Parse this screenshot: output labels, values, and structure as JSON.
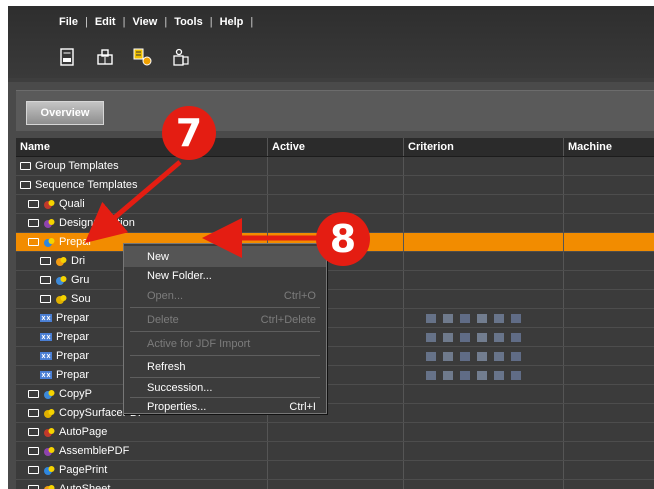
{
  "menu": {
    "items": [
      "File",
      "Edit",
      "View",
      "Tools",
      "Help"
    ]
  },
  "toolbar": {
    "icons": [
      "document-abc-icon",
      "printer-pages-icon",
      "workflow-settings-icon",
      "user-organizer-icon"
    ]
  },
  "overview_tab": "Overview",
  "columns": [
    "Name",
    "Active",
    "Criterion",
    "Machine"
  ],
  "rows": [
    {
      "name": "Group Templates",
      "indent": 0,
      "icon": "folder",
      "selected": false
    },
    {
      "name": "Sequence Templates",
      "indent": 0,
      "icon": "folder-open",
      "selected": false
    },
    {
      "name": "Quali",
      "indent": 1,
      "icon": "folder-badge",
      "selected": false
    },
    {
      "name": "DesignCreation",
      "indent": 1,
      "icon": "folder-badge",
      "selected": false
    },
    {
      "name": "Prepar",
      "indent": 1,
      "icon": "folder-open-badge",
      "selected": true
    },
    {
      "name": "Dri",
      "indent": 2,
      "icon": "folder-badge",
      "selected": false
    },
    {
      "name": "Gru",
      "indent": 2,
      "icon": "folder-badge",
      "selected": false
    },
    {
      "name": "Sou",
      "indent": 2,
      "icon": "folder-badge",
      "selected": false
    },
    {
      "name": "Prepar",
      "indent": 2,
      "icon": "sequence",
      "selected": false
    },
    {
      "name": "Prepar",
      "indent": 2,
      "icon": "sequence",
      "selected": false
    },
    {
      "name": "Prepar",
      "indent": 2,
      "icon": "sequence",
      "selected": false
    },
    {
      "name": "Prepar",
      "indent": 2,
      "icon": "sequence",
      "selected": false
    },
    {
      "name": "CopyP",
      "indent": 1,
      "icon": "folder-badge",
      "selected": false
    },
    {
      "name": "CopySurfacePDF",
      "indent": 1,
      "icon": "folder-badge",
      "selected": false
    },
    {
      "name": "AutoPage",
      "indent": 1,
      "icon": "folder-badge",
      "selected": false
    },
    {
      "name": "AssemblePDF",
      "indent": 1,
      "icon": "folder-badge",
      "selected": false
    },
    {
      "name": "PagePrint",
      "indent": 1,
      "icon": "folder-badge",
      "selected": false
    },
    {
      "name": "AutoSheet",
      "indent": 1,
      "icon": "folder-badge",
      "selected": false
    }
  ],
  "criterion_icons": [
    "doc-icon",
    "preview-icon",
    "edit-icon",
    "settings-icon",
    "grid-icon",
    "check-icon"
  ],
  "context_menu": {
    "items": [
      {
        "label": "New",
        "shortcut": "",
        "enabled": true
      },
      {
        "label": "New Folder...",
        "shortcut": "",
        "enabled": true
      },
      {
        "label": "Open...",
        "shortcut": "Ctrl+O",
        "enabled": false
      },
      {
        "label": "Delete",
        "shortcut": "Ctrl+Delete",
        "enabled": false
      },
      {
        "label": "Active for JDF Import",
        "shortcut": "",
        "enabled": false
      },
      {
        "label": "Refresh",
        "shortcut": "",
        "enabled": true
      },
      {
        "label": "Succession...",
        "shortcut": "",
        "enabled": true
      },
      {
        "label": "Properties...",
        "shortcut": "Ctrl+I",
        "enabled": true
      }
    ]
  },
  "callouts": [
    "7",
    "8"
  ],
  "colors": {
    "selection": "#f28c00",
    "callout": "#e41d12",
    "background": "#3b3b3b"
  }
}
